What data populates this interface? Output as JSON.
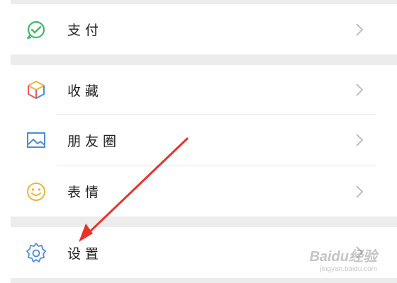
{
  "menu": {
    "pay": {
      "label": "支付",
      "icon": "pay-check-icon",
      "color": "#3cba6a"
    },
    "favorites": {
      "label": "收藏",
      "icon": "cube-icon",
      "color": "#f0b43c"
    },
    "moments": {
      "label": "朋友圈",
      "icon": "picture-icon",
      "color": "#4a8dd8"
    },
    "stickers": {
      "label": "表情",
      "icon": "smile-icon",
      "color": "#f0b43c"
    },
    "settings": {
      "label": "设置",
      "icon": "gear-icon",
      "color": "#4a8dd8"
    }
  },
  "annotation": {
    "arrow_color": "#e8322a"
  },
  "watermark": {
    "title": "Baidu经验",
    "url": "jingyan.baidu.com"
  }
}
